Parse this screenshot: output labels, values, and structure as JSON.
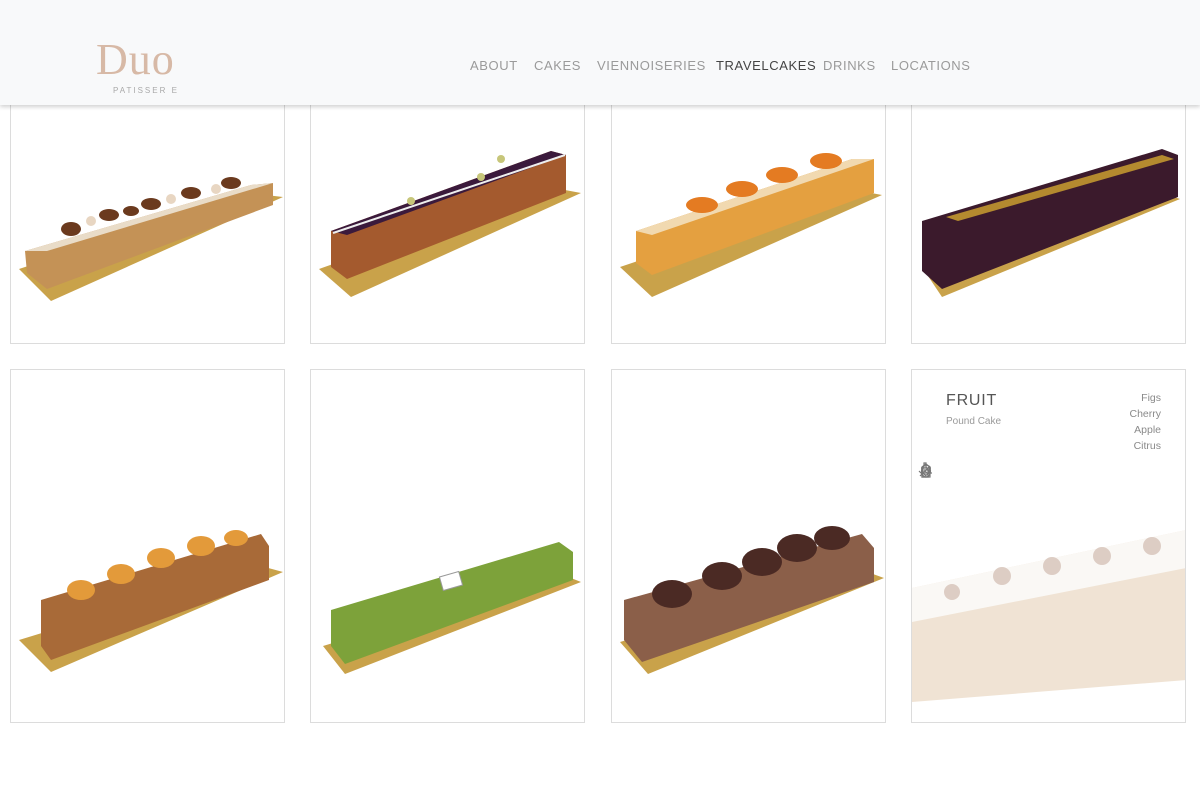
{
  "brand": {
    "name": "Duo",
    "tagline": "PATISSER E"
  },
  "nav": {
    "items": [
      {
        "label": "ABOUT"
      },
      {
        "label": "CAKES"
      },
      {
        "label": "VIENNOISERIES"
      },
      {
        "label": "TRAVELCAKES"
      },
      {
        "label": "DRINKS"
      },
      {
        "label": "LOCATIONS"
      }
    ],
    "active": "TRAVELCAKES"
  },
  "info_card": {
    "title": "FRUIT",
    "subtitle": "Pound Cake",
    "flavors": [
      "Figs",
      "Cherry",
      "Apple",
      "Citrus"
    ],
    "icons": [
      "wheat-icon",
      "milk-carton-icon",
      "egg-icon",
      "nut-icon",
      "alcohol-bottle-icon"
    ]
  },
  "colors": {
    "header_bg": "#f8f9fa",
    "logo": "#d7b9a6",
    "nav_text": "#9a9a9a",
    "nav_active": "#444444",
    "card_border": "#dcdcdc"
  }
}
